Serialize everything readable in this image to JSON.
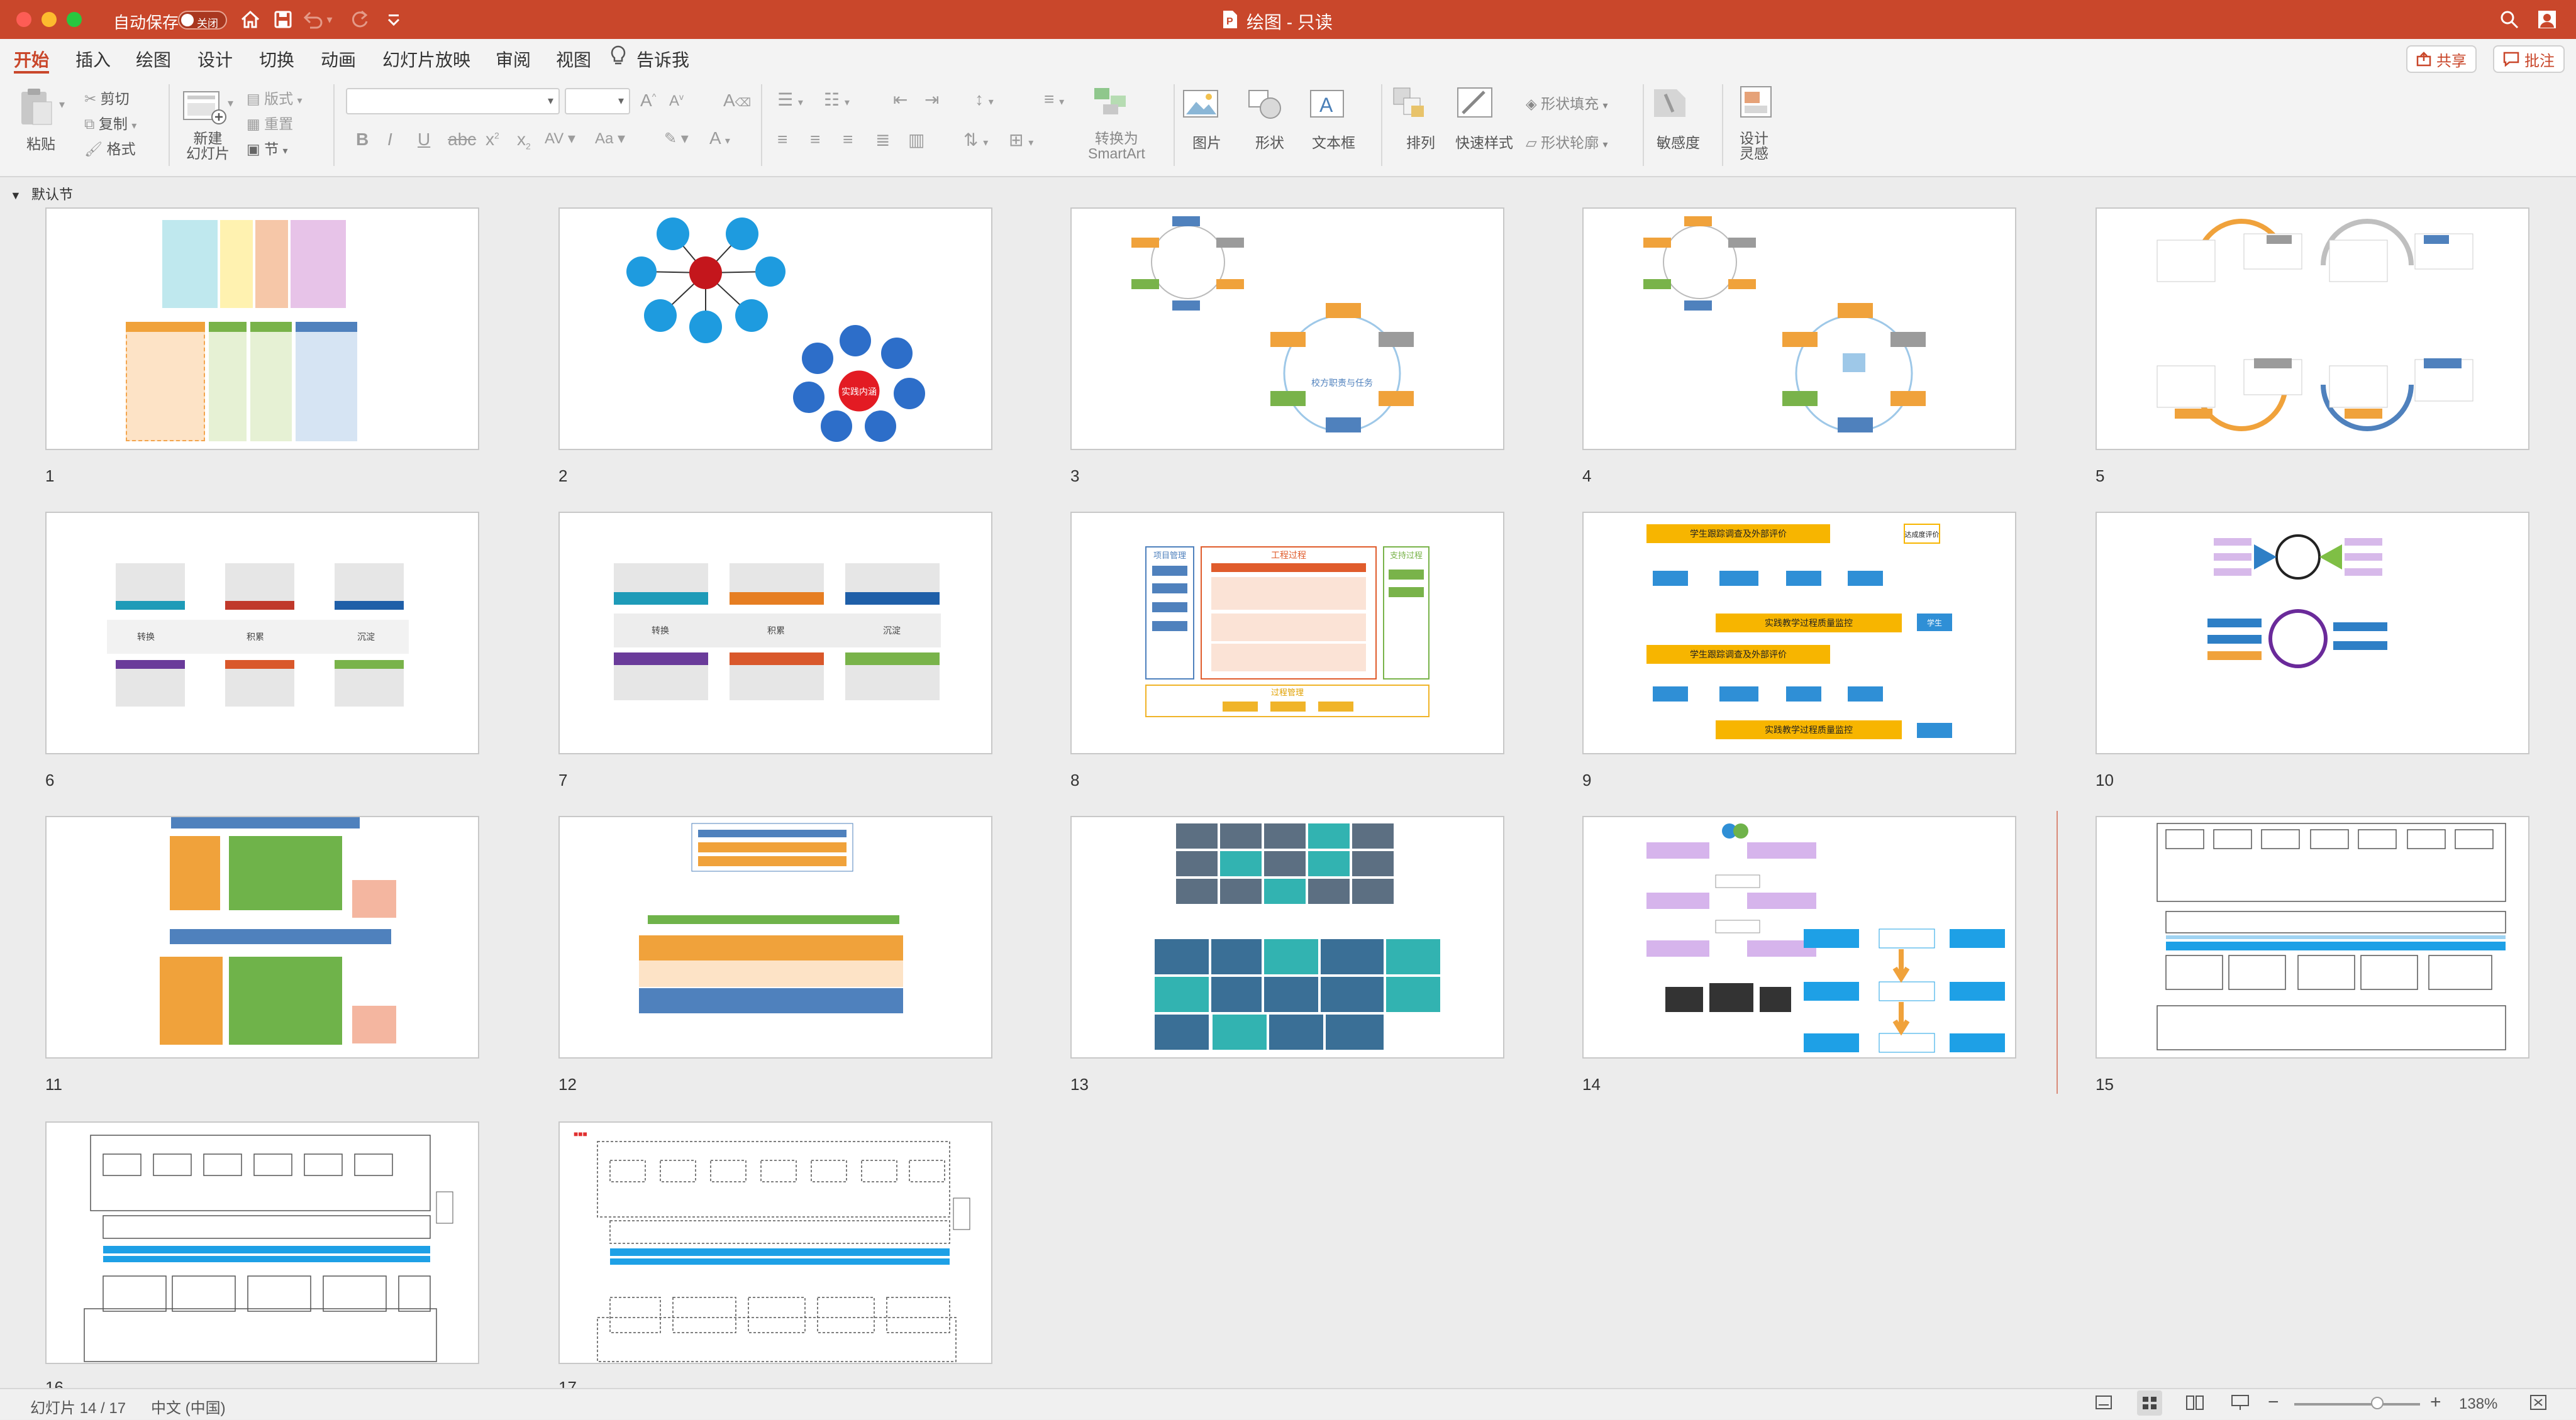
{
  "window": {
    "autosave_label": "自动保存",
    "autosave_state": "关闭",
    "title": "绘图 - 只读",
    "accent": "#c9472b"
  },
  "ribbon_tabs": [
    "开始",
    "插入",
    "绘图",
    "设计",
    "切换",
    "动画",
    "幻灯片放映",
    "审阅",
    "视图"
  ],
  "tell_me": "告诉我",
  "share_label": "共享",
  "comments_label": "批注",
  "ribbon": {
    "paste": "粘贴",
    "cut": "剪切",
    "copy": "复制",
    "format": "格式",
    "new_slide": "新建\n幻灯片",
    "layout": "版式",
    "reset": "重置",
    "section": "节",
    "convert_smartart": "转换为\nSmartArt",
    "picture": "图片",
    "shape": "形状",
    "textbox": "文本框",
    "arrange": "排列",
    "quick_styles": "快速样式",
    "shape_fill": "形状填充",
    "shape_outline": "形状轮廓",
    "sensitivity": "敏感度",
    "design_ideas": "设计\n灵感"
  },
  "section_name": "默认节",
  "slides": [
    "1",
    "2",
    "3",
    "4",
    "5",
    "6",
    "7",
    "8",
    "9",
    "10",
    "11",
    "12",
    "13",
    "14",
    "15",
    "16",
    "17"
  ],
  "selected_slide": "14",
  "slide_texts": {
    "s2_center": "实践内涵",
    "s3_center": "校方职责与任务",
    "s6_labels": [
      "转换",
      "积累",
      "沉淀"
    ],
    "s7_labels": [
      "转换",
      "积累",
      "沉淀"
    ],
    "s8_title": "工程过程",
    "s8_left": "项目管理",
    "s8_right": "支持过程",
    "s8_bottom": "过程管理",
    "s9_top": "学生跟踪调查及外部评价",
    "s9_mid": "实践教学过程质量监控",
    "s9_mid2": "学生跟踪调查及外部评价",
    "s9_bottom": "实践教学过程质量监控",
    "s9_side": "达成度评价",
    "s9_student": "学生"
  },
  "status": {
    "slide_info": "幻灯片 14 / 17",
    "language": "中文 (中国)",
    "zoom": "138%"
  }
}
